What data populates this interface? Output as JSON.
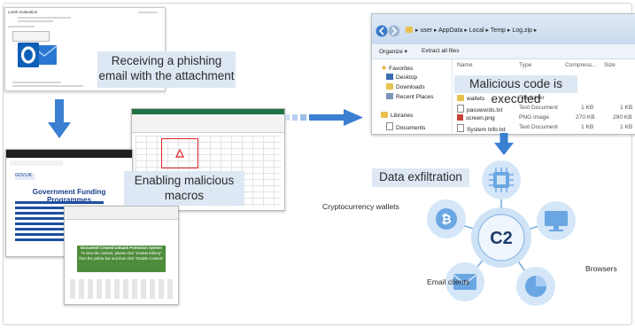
{
  "steps": {
    "phishing": "Receiving a phishing email with the attachment",
    "macros": "Enabling malicious macros",
    "executed": "Malicious code is executed",
    "exfil": "Data exfiltration"
  },
  "email_screenshot": {
    "subject": "Loreh evaluation",
    "icon": "outlook-icon"
  },
  "gov_doc": {
    "header": "GOV.UK",
    "title": "Government Funding Programmes"
  },
  "protection_doc": {
    "title": "Document Created Unbank Protection System",
    "text": "To view the content, please click \"Enable Editing\" from the yellow bar and then click \"Enable Content\""
  },
  "explorer": {
    "path": [
      "user",
      "AppData",
      "Local",
      "Temp",
      "Log.zip"
    ],
    "toolbar": [
      "Organize ▾",
      "Extract all files"
    ],
    "columns": [
      "Name",
      "Type",
      "Compress...",
      "Size"
    ],
    "sidebar": [
      "Favorites",
      "Desktop",
      "Downloads",
      "Recent Places",
      "Libraries",
      "Documents"
    ],
    "files": [
      {
        "name": "wallets",
        "type": "File folder",
        "compressed": "",
        "size": ""
      },
      {
        "name": "passwords.txt",
        "type": "Text Document",
        "compressed": "1 KB",
        "size": "1 KB"
      },
      {
        "name": "screen.png",
        "type": "PNG image",
        "compressed": "270 KB",
        "size": "290 KB"
      },
      {
        "name": "System Info.txt",
        "type": "Text Document",
        "compressed": "1 KB",
        "size": "1 KB"
      }
    ]
  },
  "c2": {
    "center": "C2",
    "targets": [
      "Cryptocurrency wallets",
      "Email clients",
      "Browsers"
    ]
  },
  "colors": {
    "arrow": "#3a7fd1",
    "caption_bg": "#dde8f4",
    "node": "#d4e6f8",
    "spoke": "#79aede",
    "icon": "#6aa6e2"
  }
}
